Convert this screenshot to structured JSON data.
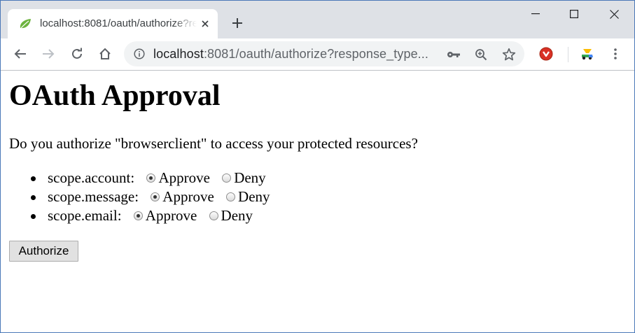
{
  "browser": {
    "tab_title": "localhost:8081/oauth/authorize?response_type",
    "new_tab_icon": "plus-icon",
    "window_controls": [
      "minimize-icon",
      "maximize-icon",
      "close-icon"
    ]
  },
  "toolbar": {
    "url_host": "localhost",
    "url_rest": ":8081/oauth/authorize?response_type...",
    "icons": [
      "back-arrow-icon",
      "forward-arrow-icon",
      "reload-icon",
      "home-icon",
      "info-icon",
      "key-icon",
      "zoom-icon",
      "star-icon",
      "extension-download-icon",
      "extension-icon",
      "menu-icon"
    ]
  },
  "page": {
    "heading": "OAuth Approval",
    "question": "Do you authorize \"browserclient\" to access your protected resources?",
    "scopes": [
      {
        "label": "scope.account:",
        "approve": "Approve",
        "deny": "Deny",
        "selected": "Approve"
      },
      {
        "label": "scope.message:",
        "approve": "Approve",
        "deny": "Deny",
        "selected": "Approve"
      },
      {
        "label": "scope.email:",
        "approve": "Approve",
        "deny": "Deny",
        "selected": "Approve"
      }
    ],
    "authorize_label": "Authorize"
  },
  "colors": {
    "tabstrip_bg": "#dee1e6",
    "omnibox_bg": "#f1f3f4",
    "window_border": "#4a78b8"
  }
}
